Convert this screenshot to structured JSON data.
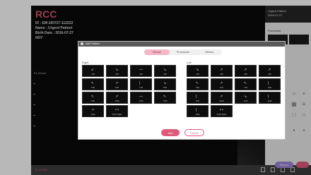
{
  "patient": {
    "logo": "RCC",
    "id_line": "ID : EM-160727-112222",
    "name_line": "Name : Urgent Patient",
    "birth_line": "Birth Date : 2016-07-27",
    "age_sex": "0/0Y"
  },
  "viewer": {
    "depth_label": "E1.20mm"
  },
  "bottom_bar": {
    "status_label": "B: 120/60"
  },
  "right_panel": {
    "patient_name": "Urgent Patient",
    "patient_date": "2016-07-27",
    "procedure_label": "Procedure",
    "primary_button": "Report",
    "icons": [
      "search-icon",
      "zoom-in-icon",
      "grid-icon",
      "list-icon",
      "square-icon",
      "circle-icon",
      "layout-icon",
      "more-icon"
    ]
  },
  "dialog": {
    "title": "Add Position",
    "tabs": [
      {
        "label": "Breast",
        "active": true
      },
      {
        "label": "Procedure",
        "active": false
      },
      {
        "label": "Others",
        "active": false
      }
    ],
    "right_label": "Right",
    "left_label": "Left",
    "right_thumbs": [
      {
        "label": "1:00",
        "glyph": "↙"
      },
      {
        "label": "2:00",
        "glyph": "↘"
      },
      {
        "label": "3:00",
        "glyph": "—"
      },
      {
        "label": "4:00",
        "glyph": "↘"
      },
      {
        "label": "5:00",
        "glyph": "↖"
      },
      {
        "label": "6:00",
        "glyph": "↗"
      },
      {
        "label": "7:00",
        "glyph": "|"
      },
      {
        "label": "8:00",
        "glyph": "↘"
      },
      {
        "label": "9:00",
        "glyph": "↖"
      },
      {
        "label": "10:00",
        "glyph": "↗"
      },
      {
        "label": "11:00",
        "glyph": "—"
      },
      {
        "label": "12:00",
        "glyph": "↖"
      },
      {
        "label": "Axilla",
        "glyph": "↗"
      },
      {
        "label": "SCAN Nipple",
        "glyph": "• •"
      }
    ],
    "left_thumbs": [
      {
        "label": "1:00",
        "glyph": "↘"
      },
      {
        "label": "2:00",
        "glyph": "↗"
      },
      {
        "label": "3:00",
        "glyph": "↗"
      },
      {
        "label": "4:00",
        "glyph": "↗"
      },
      {
        "label": "5:00",
        "glyph": "↖"
      },
      {
        "label": "6:00",
        "glyph": "↗"
      },
      {
        "label": "7:00",
        "glyph": "↖"
      },
      {
        "label": "8:00",
        "glyph": "|"
      },
      {
        "label": "9:00",
        "glyph": "|"
      },
      {
        "label": "10:00",
        "glyph": "↗"
      },
      {
        "label": "11:00",
        "glyph": "↘"
      },
      {
        "label": "12:00",
        "glyph": "|"
      },
      {
        "label": "Axilla",
        "glyph": "|"
      },
      {
        "label": "SCAN Nipple",
        "glyph": "• •"
      }
    ],
    "add_label": "Add",
    "cancel_label": "Cancel"
  },
  "colors": {
    "accent": "#e0597a",
    "tab_active": "#f3b7c6",
    "viewer_bg": "#0a0a0a"
  }
}
